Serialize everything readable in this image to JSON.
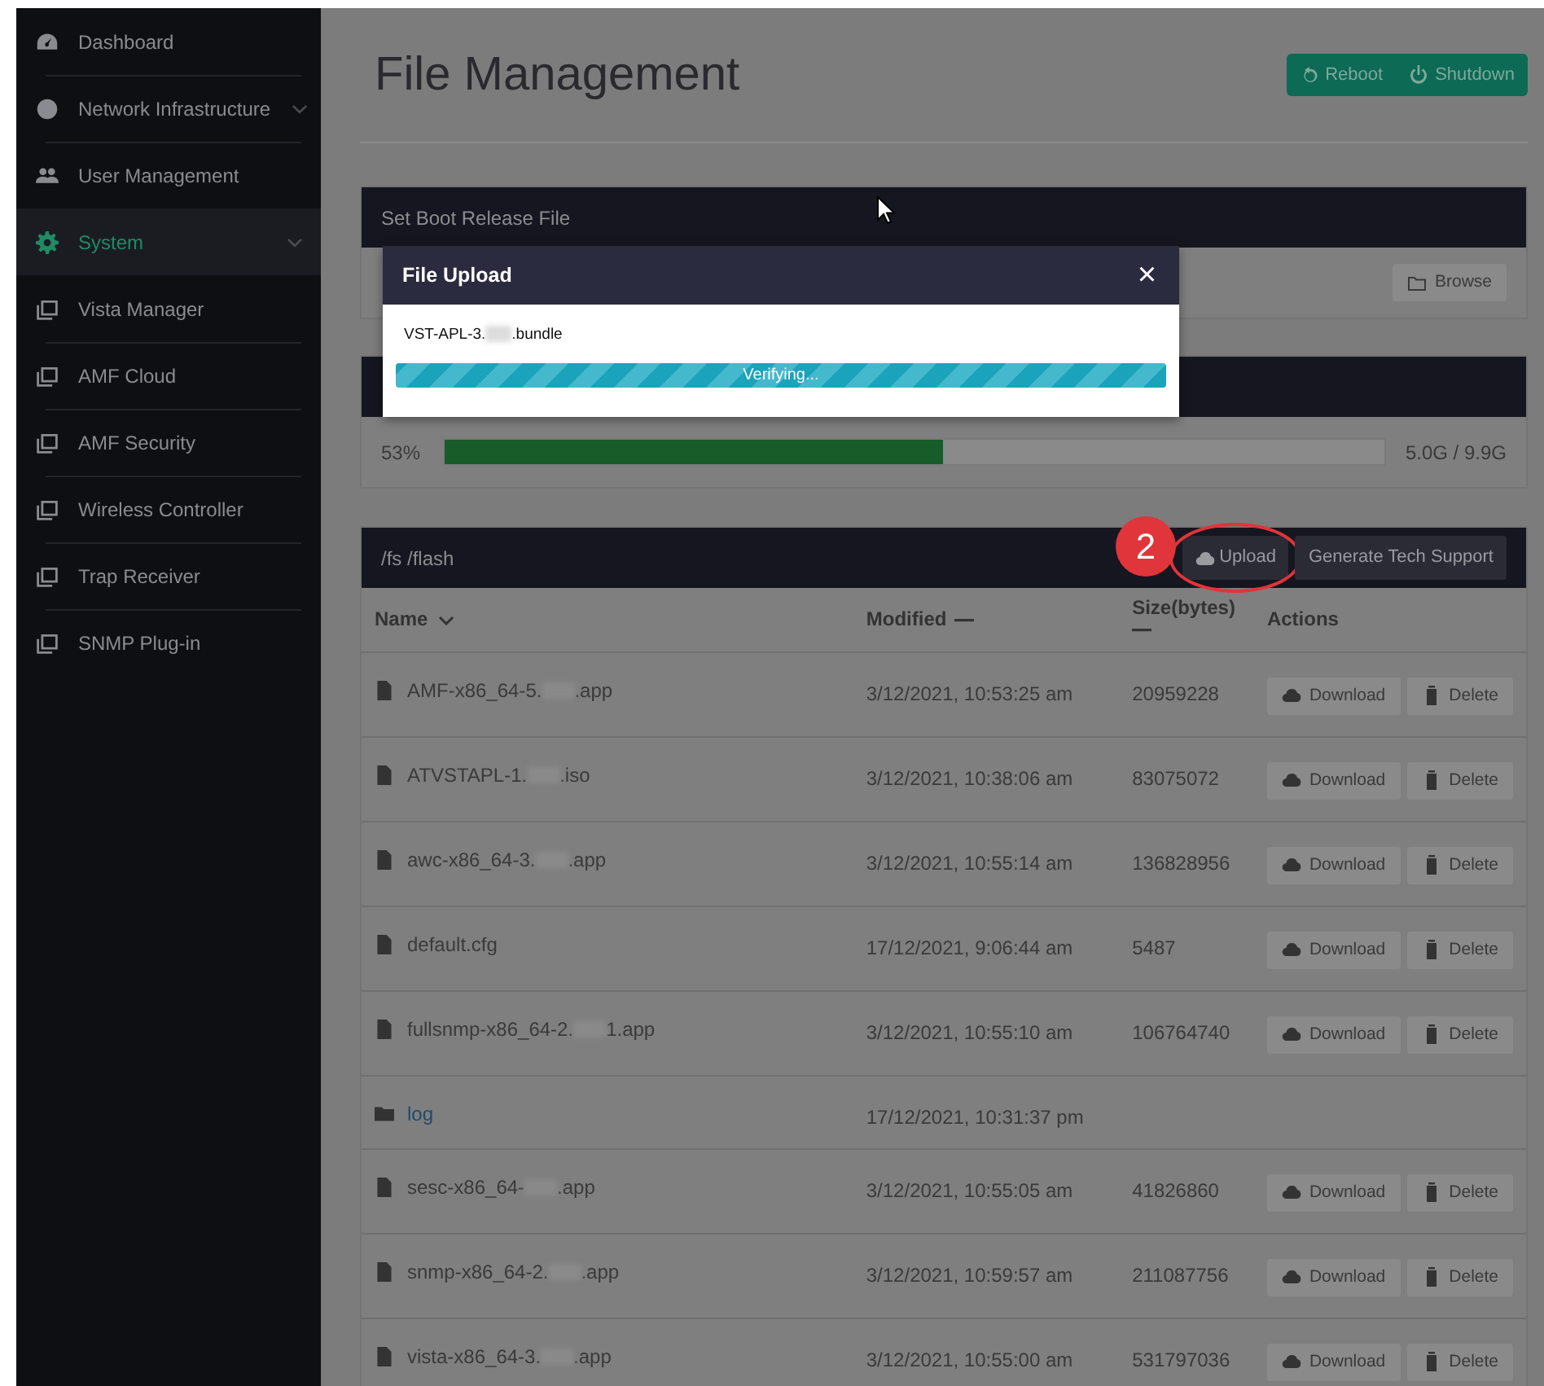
{
  "sidebar": {
    "items": [
      {
        "label": "Dashboard",
        "selected": false,
        "has_submenu": false
      },
      {
        "label": "Network Infrastructure",
        "selected": false,
        "has_submenu": true
      },
      {
        "label": "User Management",
        "selected": false,
        "has_submenu": false
      },
      {
        "label": "System",
        "selected": true,
        "has_submenu": true
      },
      {
        "label": "Vista Manager",
        "selected": false,
        "has_submenu": false
      },
      {
        "label": "AMF Cloud",
        "selected": false,
        "has_submenu": false
      },
      {
        "label": "AMF Security",
        "selected": false,
        "has_submenu": false
      },
      {
        "label": "Wireless Controller",
        "selected": false,
        "has_submenu": false
      },
      {
        "label": "Trap Receiver",
        "selected": false,
        "has_submenu": false
      },
      {
        "label": "SNMP Plug-in",
        "selected": false,
        "has_submenu": false
      }
    ]
  },
  "header": {
    "title": "File Management",
    "buttons": [
      "Reboot",
      "Shutdown"
    ]
  },
  "boot_card": {
    "title": "Set Boot Release File",
    "browse_button": "Browse"
  },
  "storage_card": {
    "percent": "53%",
    "level": 0.53,
    "usage": "5.0G / 9.9G"
  },
  "files_card": {
    "path": "/fs /flash",
    "upload_button": "Upload",
    "tech_support_button": "Generate Tech Support",
    "columns": [
      {
        "label": "Name",
        "sorted": true
      },
      {
        "label": "Modified",
        "sorted": false
      },
      {
        "label": "Size(bytes)",
        "sorted": false
      },
      {
        "label": "Actions",
        "sortable": false
      }
    ],
    "rows": [
      {
        "kind": "file",
        "name_start": "AMF-x86_64-5.",
        "redacted": true,
        "name_end": ".app",
        "modified": "3/12/2021, 10:53:25 am",
        "size": "20959228",
        "actions": [
          "Download",
          "Delete"
        ]
      },
      {
        "kind": "file",
        "name_start": "ATVSTAPL-1.",
        "redacted": true,
        "name_end": ".iso",
        "modified": "3/12/2021, 10:38:06 am",
        "size": "83075072",
        "actions": [
          "Download",
          "Delete"
        ]
      },
      {
        "kind": "file",
        "name_start": "awc-x86_64-3.",
        "redacted": true,
        "name_end": ".app",
        "modified": "3/12/2021, 10:55:14 am",
        "size": "136828956",
        "actions": [
          "Download",
          "Delete"
        ]
      },
      {
        "kind": "file",
        "name_start": "default.cfg",
        "redacted": false,
        "modified": "17/12/2021, 9:06:44 am",
        "size": "5487",
        "actions": [
          "Download",
          "Delete"
        ]
      },
      {
        "kind": "file",
        "name_start": "fullsnmp-x86_64-2.",
        "redacted": true,
        "name_end": "1.app",
        "modified": "3/12/2021, 10:55:10 am",
        "size": "106764740",
        "actions": [
          "Download",
          "Delete"
        ]
      },
      {
        "kind": "folder",
        "name_start": "log",
        "redacted": false,
        "modified": "17/12/2021, 10:31:37 pm"
      },
      {
        "kind": "file",
        "name_start": "sesc-x86_64-",
        "redacted": true,
        "name_end": ".app",
        "modified": "3/12/2021, 10:55:05 am",
        "size": "41826860",
        "actions": [
          "Download",
          "Delete"
        ]
      },
      {
        "kind": "file",
        "name_start": "snmp-x86_64-2.",
        "redacted": true,
        "name_end": ".app",
        "modified": "3/12/2021, 10:59:57 am",
        "size": "211087756",
        "actions": [
          "Download",
          "Delete"
        ]
      },
      {
        "kind": "file",
        "name_start": "vista-x86_64-3.",
        "redacted": true,
        "name_end": ".app",
        "modified": "3/12/2021, 10:55:00 am",
        "size": "531797036",
        "actions": [
          "Download",
          "Delete"
        ]
      }
    ]
  },
  "modal": {
    "title": "File Upload",
    "close": "×",
    "filename_start": "VST-APL-3.",
    "redacted": true,
    "filename_end": ".bundle",
    "progress_label": "Verifying...",
    "level": 1
  },
  "annotation": {
    "number": "2"
  }
}
